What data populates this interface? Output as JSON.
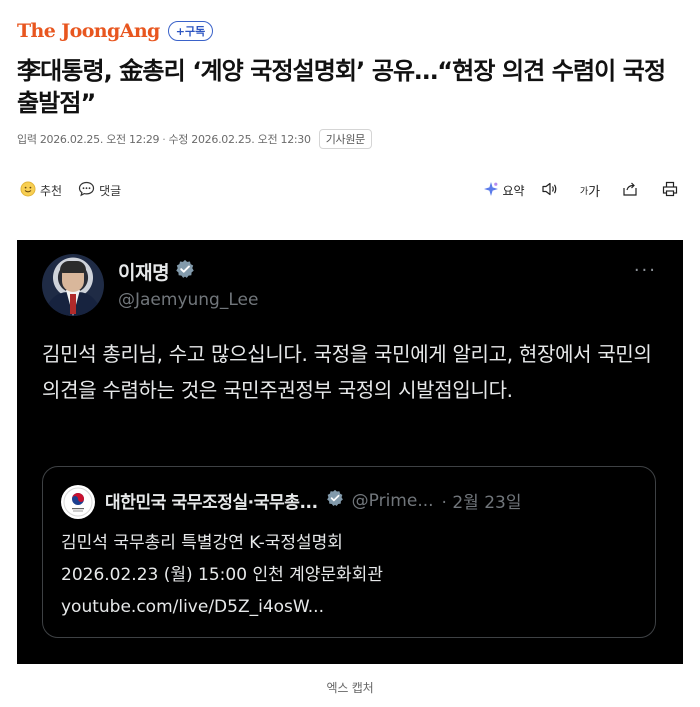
{
  "header": {
    "logo": "The JoongAng",
    "subscribe_label": "+구독"
  },
  "article": {
    "headline": "李대통령, 金총리 ‘계양 국정설명회’ 공유…“현장 의견 수렴이 국정 출발점”",
    "published": "입력 2026.02.25. 오전 12:29",
    "meta_sep": "·",
    "modified": "수정 2026.02.25. 오전 12:30",
    "origin_label": "기사원문"
  },
  "actions": {
    "recommend_label": "추천",
    "comment_label": "댓글",
    "summary_label": "요약",
    "fontsize_small": "가",
    "fontsize_big": "가"
  },
  "tweet": {
    "name": "이재명",
    "handle": "@Jaemyung_Lee",
    "more": "···",
    "body": "김민석 총리님, 수고 많으십니다. 국정을 국민에게 알리고, 현장에서 국민의 의견을 수렴하는 것은 국민주권정부 국정의 시발점입니다.",
    "quote": {
      "name": "대한민국 국무조정실·국무총...",
      "handle": "@Prime...",
      "date": "· 2월 23일",
      "lines": [
        "김민석 국무총리 특별강연 K-국정설명회",
        "2026.02.23 (월) 15:00 인천 계양문화회관",
        "youtube.com/live/D5Z_i4osW..."
      ]
    }
  },
  "caption": "엑스 캡처",
  "colors": {
    "brand": "#e8561f",
    "subscribe": "#2e56c2",
    "verified": "#829aab",
    "tweet_bg": "#000000"
  }
}
